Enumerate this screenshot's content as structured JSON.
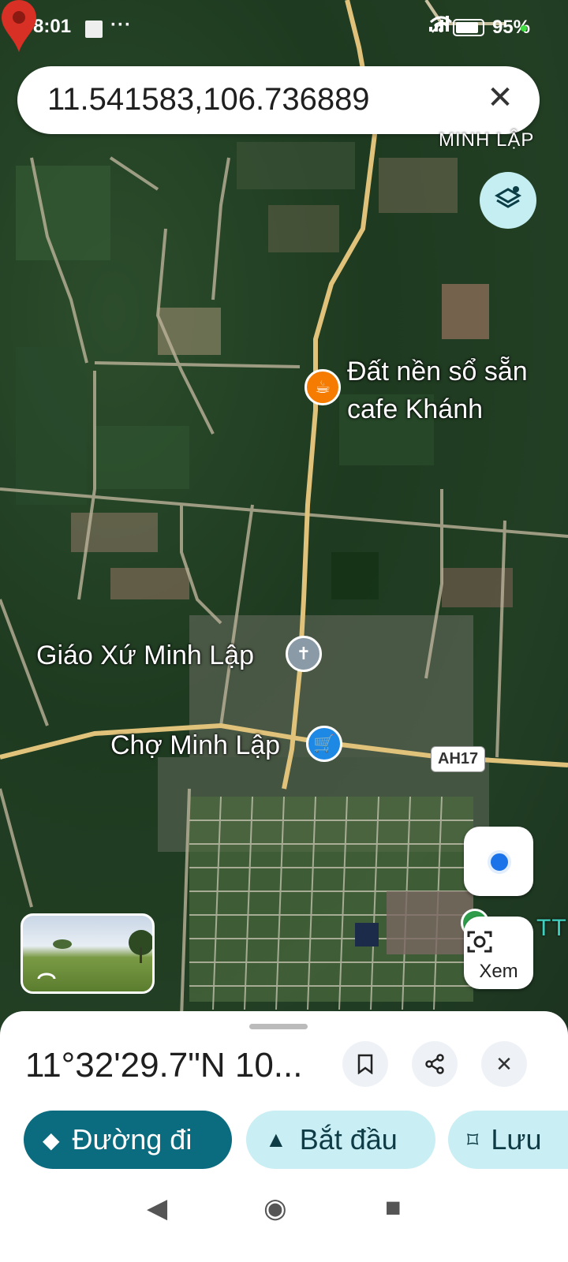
{
  "status_bar": {
    "time": "8:01",
    "dots": "···",
    "battery": "95%"
  },
  "search": {
    "query": "11.541583,106.736889"
  },
  "map": {
    "area_label": "MINH LẬP",
    "poi_cafe": {
      "line1": "Đất nền sổ sẵn",
      "line2": "cafe Khánh"
    },
    "poi_church": "Giáo Xứ Minh Lập",
    "poi_market": "Chợ Minh Lập",
    "road_shield": "AH17",
    "edge_label": "TT"
  },
  "controls": {
    "xem_label": "Xem"
  },
  "sheet": {
    "coordinates": "11°32'29.7\"N 10...",
    "actions": [
      {
        "label": "Đường đi",
        "icon": "directions-icon"
      },
      {
        "label": "Bắt đầu",
        "icon": "navigate-arrow-icon"
      },
      {
        "label": "Lưu",
        "icon": "bookmark-icon"
      }
    ]
  },
  "colors": {
    "primary": "#0b6b7f",
    "secondary": "#c9eef4",
    "pin": "#d93025",
    "cafe": "#f57c00",
    "market": "#1e88e5"
  }
}
